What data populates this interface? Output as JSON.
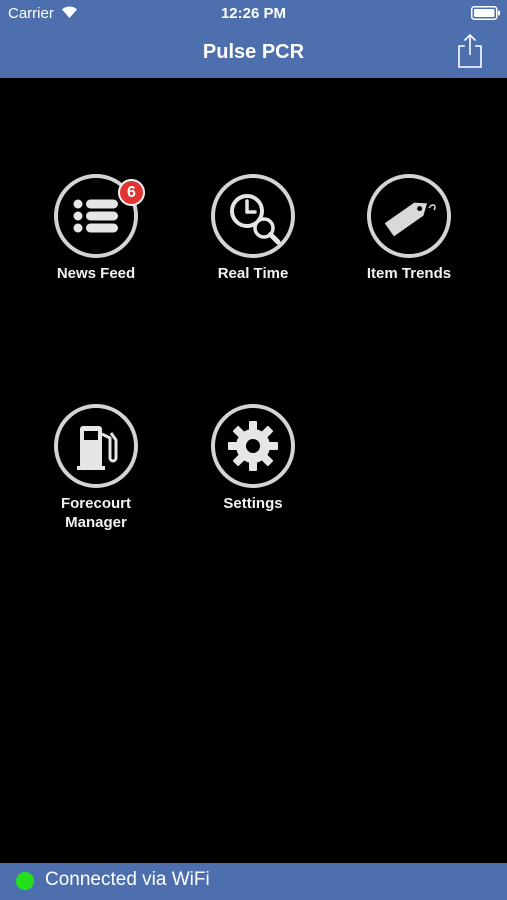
{
  "status_bar": {
    "carrier": "Carrier",
    "time": "12:26 PM",
    "wifi_icon": "wifi-icon",
    "battery_icon": "battery-icon"
  },
  "nav": {
    "title": "Pulse PCR",
    "share_icon": "share-icon"
  },
  "tiles": [
    {
      "label": "News Feed",
      "icon": "list-icon",
      "badge": "6"
    },
    {
      "label": "Real Time",
      "icon": "clock-search-icon"
    },
    {
      "label": "Item Trends",
      "icon": "tag-icon"
    },
    {
      "label": "Forecourt Manager",
      "icon": "fuel-pump-icon"
    },
    {
      "label": "Settings",
      "icon": "gear-icon"
    }
  ],
  "footer": {
    "text": "Connected via WiFi",
    "status_color": "#22e01b"
  },
  "colors": {
    "bar_background": "#4d6fae",
    "screen_background": "#000000",
    "icon_ring": "#d4d4d4",
    "badge": "#e03533"
  }
}
